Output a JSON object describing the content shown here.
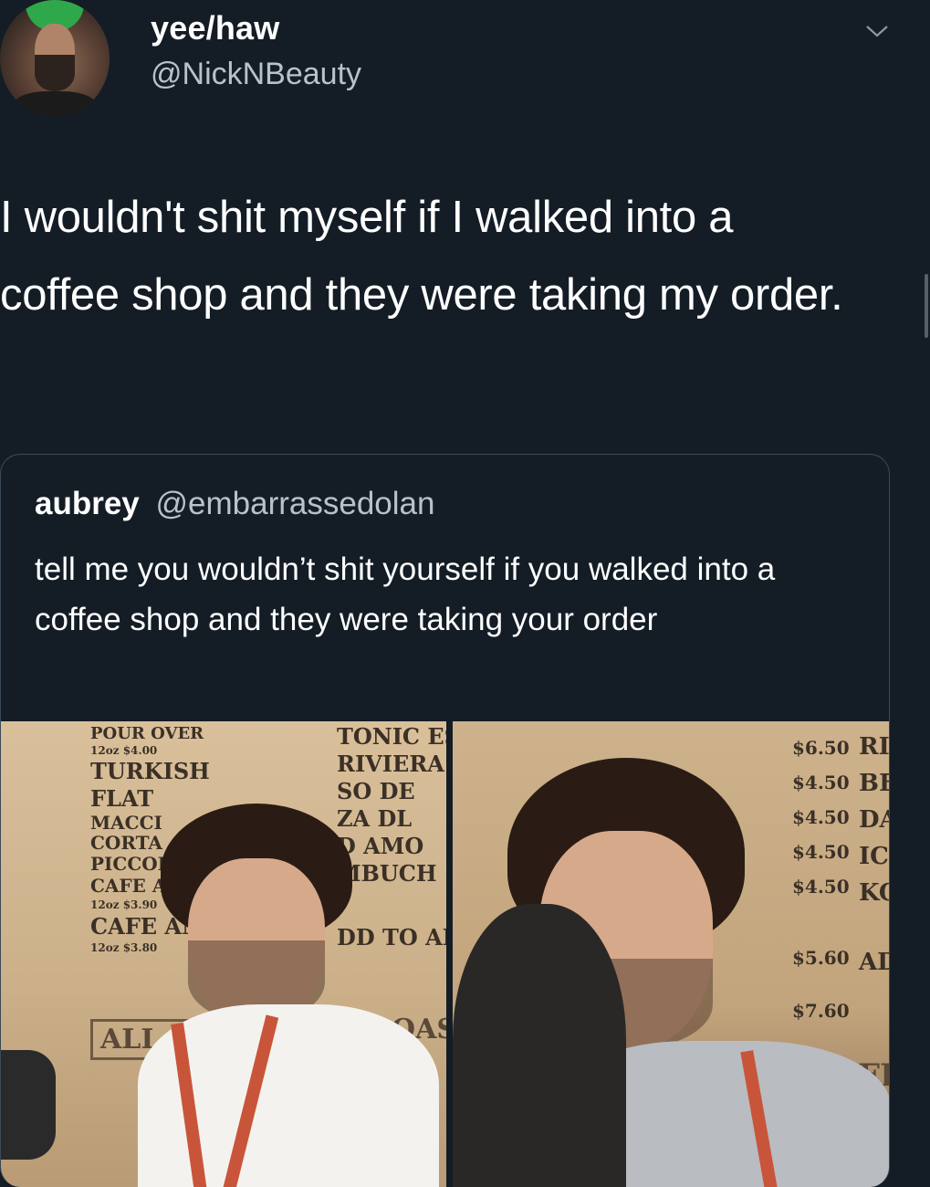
{
  "tweet": {
    "display_name": "yee/haw",
    "handle": "@NickNBeauty",
    "text": "I wouldn't shit myself if I walked into a coffee shop and they were taking my order.",
    "avatar_icon": "profile-photo",
    "menu_icon": "chevron-down-icon"
  },
  "quoted_tweet": {
    "name": "aubrey",
    "handle": "@embarrassedolan",
    "text": "tell me you wouldn’t shit yourself if you walked into a coffee shop and they were taking your order"
  },
  "media": {
    "left_menu": [
      "POUR OVER",
      "12oz $4.00",
      "TURKISH",
      "FLAT",
      "MACCI",
      "CORTA",
      "PICCOLO",
      "CAFE A",
      "12oz $3.90",
      "CAFE AN",
      "12oz $3.80"
    ],
    "left_menu_mid": [
      "TONIC ES",
      "RIVIERA",
      "SO DE",
      "ZA DL",
      "D AMO",
      "MBUCH",
      "DD TO AN"
    ],
    "left_sign": "ALL OR",
    "left_sign2": "ROAST",
    "right_prices": [
      "$6.50",
      "$4.50",
      "$4.50",
      "$4.50",
      "$4.50",
      "$5.60",
      "$7.60"
    ],
    "right_menu": [
      "RI",
      "BE",
      "DA",
      "IC",
      "KO",
      "AD"
    ],
    "right_sign": "COFFEE"
  },
  "colors": {
    "background": "#141d26",
    "text": "#ffffff",
    "secondary_text": "#b8c2cc",
    "card_border": "#3a4a5a"
  }
}
